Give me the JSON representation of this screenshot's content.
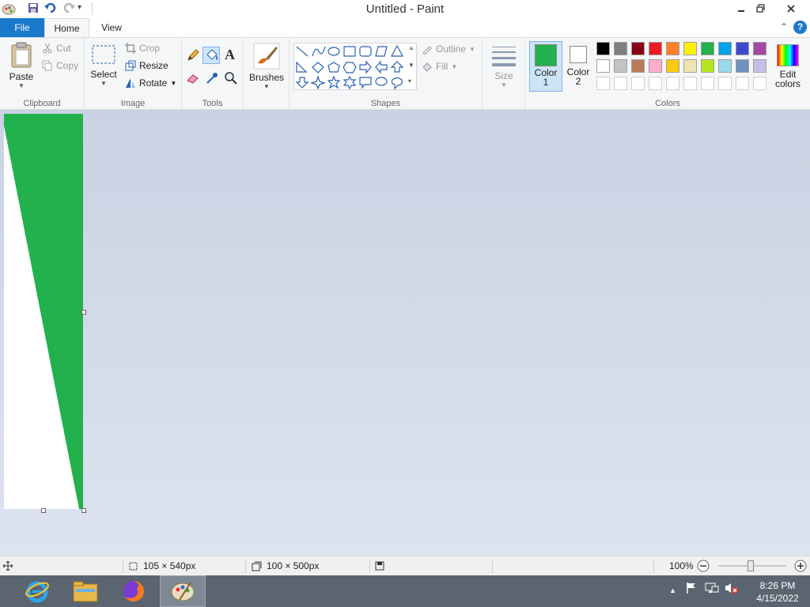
{
  "window": {
    "title": "Untitled - Paint"
  },
  "tabs": {
    "file": "File",
    "home": "Home",
    "view": "View"
  },
  "help": "?",
  "clipboard": {
    "paste": "Paste",
    "cut": "Cut",
    "copy": "Copy",
    "group": "Clipboard"
  },
  "image": {
    "select": "Select",
    "crop": "Crop",
    "resize": "Resize",
    "rotate": "Rotate",
    "group": "Image"
  },
  "tools": {
    "group": "Tools",
    "text_glyph": "A"
  },
  "brushes": {
    "label": "Brushes"
  },
  "shapes": {
    "outline": "Outline",
    "fill": "Fill",
    "group": "Shapes"
  },
  "size": {
    "label": "Size"
  },
  "colors": {
    "color1": {
      "label": "Color",
      "num": "1",
      "value": "#22b14c"
    },
    "color2": {
      "label": "Color",
      "num": "2",
      "value": "#ffffff"
    },
    "edit": "Edit colors",
    "group": "Colors",
    "palette_row1": [
      "#000000",
      "#7f7f7f",
      "#880015",
      "#ed1c24",
      "#ff7f27",
      "#fff200",
      "#22b14c",
      "#00a2e8",
      "#3f48cc",
      "#a349a4"
    ],
    "palette_row2": [
      "#ffffff",
      "#c3c3c3",
      "#b97a57",
      "#ffaec9",
      "#ffc90e",
      "#efe4b0",
      "#b5e61d",
      "#99d9ea",
      "#7092be",
      "#c8bfe7"
    ]
  },
  "canvas": {
    "fill_color": "#22b14c"
  },
  "status": {
    "cursor_pos": "105 × 540px",
    "canvas_size": "100 × 500px",
    "zoom": "100%"
  },
  "clock": {
    "time": "8:26 PM",
    "date": "4/15/2022"
  }
}
